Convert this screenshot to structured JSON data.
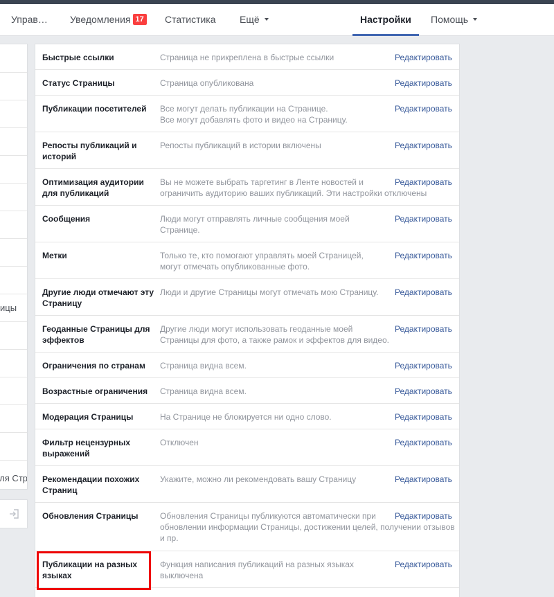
{
  "nav": {
    "manage": "Управ…",
    "notifications": "Уведомления",
    "notifications_count": "17",
    "stats": "Статистика",
    "more": "Ещё",
    "settings": "Настройки",
    "help": "Помощь"
  },
  "left": {
    "partial_1": "ицы",
    "partial_2": "ля Стр"
  },
  "rows": [
    {
      "label": "Быстрые ссылки",
      "desc": [
        "Страница не прикреплена в быстрые ссылки"
      ],
      "edit": "Редактировать"
    },
    {
      "label": "Статус Страницы",
      "desc": [
        "Страница опубликована"
      ],
      "edit": "Редактировать"
    },
    {
      "label": "Публикации посетителей",
      "desc": [
        "Все могут делать публикации на Странице.",
        "Все могут добавлять фото и видео на Страницу."
      ],
      "edit": "Редактировать"
    },
    {
      "label": "Репосты публикаций и историй",
      "desc": [
        "Репосты публикаций в истории включены"
      ],
      "edit": "Редактировать"
    },
    {
      "label": "Оптимизация аудитории для публикаций",
      "desc": [
        "Вы не можете выбрать таргетинг в Ленте новостей и",
        "ограничить аудиторию ваших публикаций. Эти настройки отключены"
      ],
      "edit": "Редактировать"
    },
    {
      "label": "Сообщения",
      "desc": [
        "Люди могут отправлять личные сообщения моей",
        "Странице."
      ],
      "edit": "Редактировать"
    },
    {
      "label": "Метки",
      "desc": [
        "Только те, кто помогают управлять моей Страницей,",
        "могут отмечать опубликованные фото."
      ],
      "edit": "Редактировать"
    },
    {
      "label": "Другие люди отмечают эту Страницу",
      "desc": [
        "Люди и другие Страницы могут отмечать мою Страницу."
      ],
      "edit": "Редактировать"
    },
    {
      "label": "Геоданные Страницы для эффектов",
      "desc": [
        "Другие люди могут использовать геоданные моей",
        "Страницы для фото, а также рамок и эффектов для видео."
      ],
      "edit": "Редактировать"
    },
    {
      "label": "Ограничения по странам",
      "desc": [
        "Страница видна всем."
      ],
      "edit": "Редактировать"
    },
    {
      "label": "Возрастные ограничения",
      "desc": [
        "Страница видна всем."
      ],
      "edit": "Редактировать"
    },
    {
      "label": "Модерация Страницы",
      "desc": [
        "На Странице не блокируется ни одно слово."
      ],
      "edit": "Редактировать"
    },
    {
      "label": "Фильтр нецензурных выражений",
      "desc": [
        "Отключен"
      ],
      "edit": "Редактировать"
    },
    {
      "label": "Рекомендации похожих Страниц",
      "desc": [
        "Укажите, можно ли рекомендовать вашу Страницу"
      ],
      "edit": "Редактировать"
    },
    {
      "label": "Обновления Страницы",
      "desc": [
        "Обновления Страницы публикуются автоматически при",
        "обновлении информации Страницы, достижении целей, получении отзывов",
        "и пр."
      ],
      "edit": "Редактировать"
    },
    {
      "label": "Публикации на разных языках",
      "desc": [
        "Функция написания публикаций на разных языках",
        "выключена"
      ],
      "edit": "Редактировать"
    }
  ]
}
